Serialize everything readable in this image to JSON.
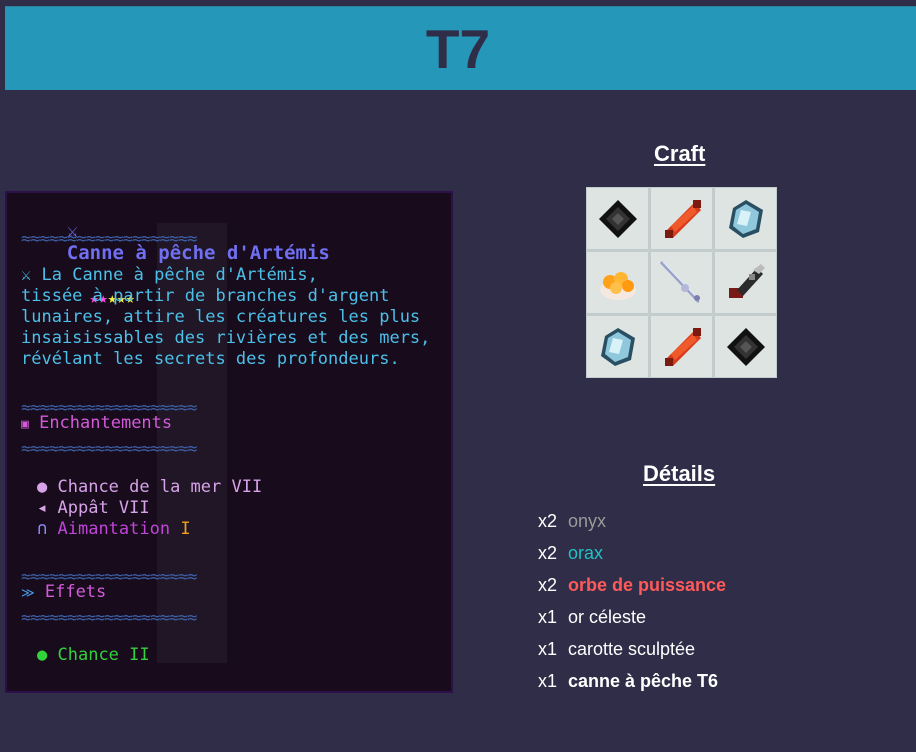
{
  "header": {
    "title": "T7"
  },
  "item": {
    "name": "Canne à pêche d'Artémis",
    "stars_filled": 5,
    "description": [
      "La Canne à pêche d'Artémis,",
      "tissée à partir de branches d'argent",
      "lunaires, attire les créatures les plus",
      "insaisissables des rivières et des mers,",
      "révélant les secrets des profondeurs."
    ],
    "separator": "≈≈≈≈≈≈≈≈≈≈≈≈≈≈≈≈≈≈≈",
    "enchant_header": "Enchantements",
    "enchants": [
      {
        "label": "Chance de la mer VII"
      },
      {
        "label": "Appât VII"
      },
      {
        "label": "Aimantation",
        "level": "I"
      }
    ],
    "effects_header": "Effets",
    "effects": [
      {
        "label": "Chance II"
      }
    ]
  },
  "craft": {
    "title": "Craft",
    "grid": [
      "onyx-icon",
      "orbe-icon",
      "orax-icon",
      "or-celeste-icon",
      "canne-icon",
      "carotte-icon",
      "orax-icon",
      "orbe-icon",
      "onyx-icon"
    ]
  },
  "details": {
    "title": "Détails",
    "items": [
      {
        "qty": "x2",
        "name": "onyx",
        "color": "#9a9a9a",
        "bold": false
      },
      {
        "qty": "x2",
        "name": "orax",
        "color": "#1fc2c2",
        "bold": false
      },
      {
        "qty": "x2",
        "name": "orbe de puissance",
        "color": "#ff5a5a",
        "bold": true
      },
      {
        "qty": "x1",
        "name": "or céleste",
        "color": "#ffffff",
        "bold": false
      },
      {
        "qty": "x1",
        "name": "carotte sculptée",
        "color": "#ffffff",
        "bold": false
      },
      {
        "qty": "x1",
        "name": "canne à pêche T6",
        "color": "#ffffff",
        "bold": true
      }
    ]
  }
}
